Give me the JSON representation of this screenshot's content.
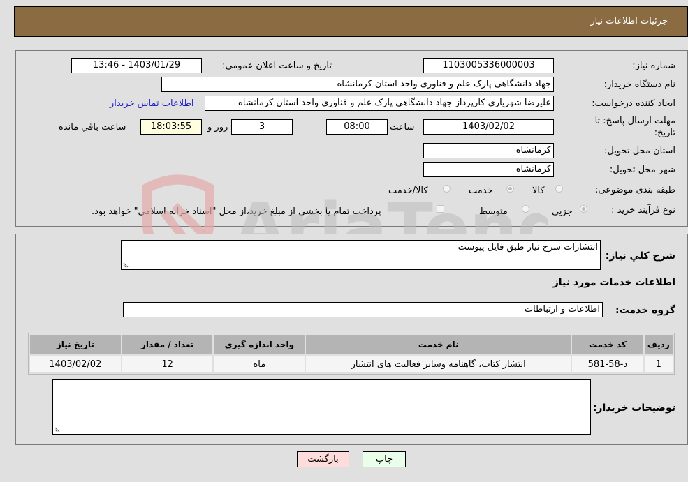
{
  "header": {
    "title": "جزئيات اطلاعات نياز"
  },
  "form": {
    "need_number_label": "شماره نياز:",
    "need_number": "1103005336000003",
    "announce_label": "تاريخ و ساعت اعلان عمومي:",
    "announce_value": "1403/01/29 - 13:46",
    "buyer_org_label": "نام دستگاه خريدار:",
    "buyer_org": "جهاد دانشگاهی پارک علم و فناوری واحد استان کرمانشاه",
    "creator_label": "ايجاد کننده درخواست:",
    "creator": "علیرضا شهریاری کارپرداز جهاد دانشگاهی پارک علم و فناوری واحد استان کرمانشاه",
    "contact_link": "اطلاعات تماس خريدار",
    "deadline_label": "مهلت ارسال پاسخ: تا تاريخ:",
    "deadline_date": "1403/02/02",
    "time_label": "ساعت",
    "deadline_time": "08:00",
    "days_value": "3",
    "days_label": "روز و",
    "remaining_time": "18:03:55",
    "remaining_label": "ساعت باقي مانده",
    "province_label": "استان محل تحويل:",
    "province": "کرمانشاه",
    "city_label": "شهر محل تحويل:",
    "city": "کرمانشاه",
    "category_label": "طبقه بندی موضوعی:",
    "category_options": [
      {
        "label": "کالا",
        "selected": false
      },
      {
        "label": "خدمت",
        "selected": true
      },
      {
        "label": "کالا/خدمت",
        "selected": false
      }
    ],
    "process_label": "نوع فرآيند خريد :",
    "process_options": [
      {
        "label": "جزيي",
        "selected": true
      },
      {
        "label": "متوسط",
        "selected": false
      }
    ],
    "payment_note": "پرداخت تمام يا بخشی از مبلغ خريد،از محل \"اسناد خزانه اسلامی\" خواهد بود."
  },
  "details": {
    "general_desc_label": "شرح کلي نياز:",
    "general_desc": "انتشارات شرح نياز طبق فايل پيوست",
    "services_heading": "اطلاعات خدمات مورد نياز",
    "service_group_label": "گروه خدمت:",
    "service_group": "اطلاعات و ارتباطات",
    "table": {
      "headers": [
        "رديف",
        "کد خدمت",
        "نام خدمت",
        "واحد اندازه گيری",
        "تعداد / مقدار",
        "تاريخ نياز"
      ],
      "rows": [
        [
          "1",
          "د-58-581",
          "انتشار کتاب، گاهنامه وساير فعاليت های انتشار",
          "ماه",
          "12",
          "1403/02/02"
        ]
      ]
    },
    "buyer_notes_label": "توضيحات خريدار:",
    "buyer_notes": ""
  },
  "buttons": {
    "print": "چاپ",
    "back": "بازگشت"
  },
  "watermark": {
    "text": "AriaTender.neT"
  },
  "colors": {
    "header_bg": "#8b6c42",
    "print_bg": "#eaffea",
    "back_bg": "#ffdcdc",
    "link": "#1a1ac8"
  }
}
